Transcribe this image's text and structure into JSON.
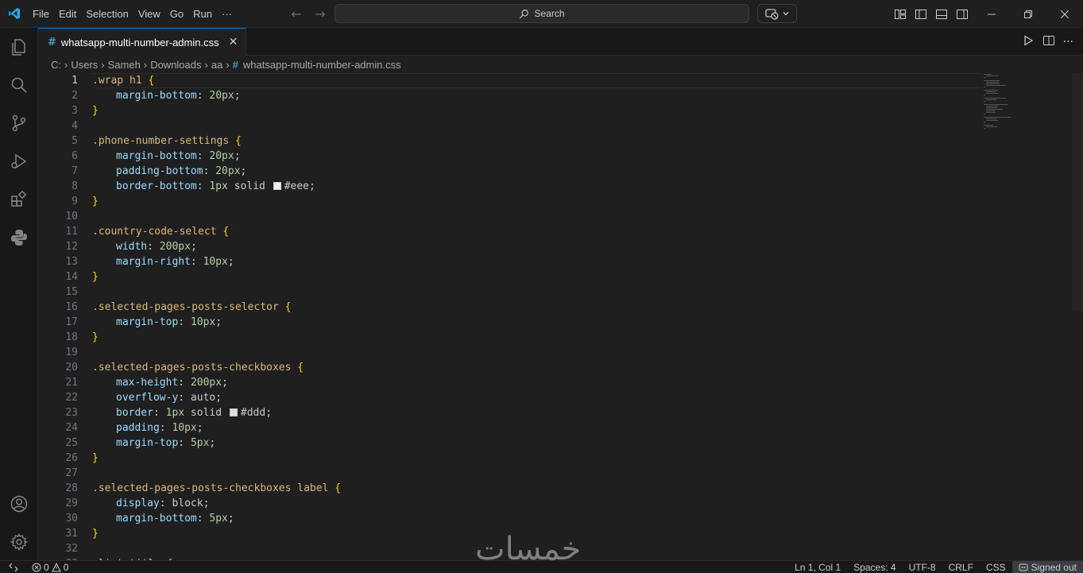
{
  "menu": [
    "File",
    "Edit",
    "Selection",
    "View",
    "Go",
    "Run",
    "···"
  ],
  "search": {
    "label": "Search"
  },
  "tab": {
    "filename": "whatsapp-multi-number-admin.css",
    "close": "✕"
  },
  "breadcrumb": [
    "C:",
    "Users",
    "Sameh",
    "Downloads",
    "aa",
    "whatsapp-multi-number-admin.css"
  ],
  "editor": {
    "active_line": 1,
    "lines": [
      [
        [
          "sel",
          ".wrap h1 "
        ],
        [
          "brace",
          "{"
        ]
      ],
      [
        [
          "ind",
          ""
        ],
        [
          "prop",
          "margin-bottom"
        ],
        [
          "val",
          ": "
        ],
        [
          "num",
          "20px"
        ],
        [
          "val",
          ";"
        ]
      ],
      [
        [
          "brace",
          "}"
        ]
      ],
      [],
      [
        [
          "sel",
          ".phone-number-settings "
        ],
        [
          "brace",
          "{"
        ]
      ],
      [
        [
          "ind",
          ""
        ],
        [
          "prop",
          "margin-bottom"
        ],
        [
          "val",
          ": "
        ],
        [
          "num",
          "20px"
        ],
        [
          "val",
          ";"
        ]
      ],
      [
        [
          "ind",
          ""
        ],
        [
          "prop",
          "padding-bottom"
        ],
        [
          "val",
          ": "
        ],
        [
          "num",
          "20px"
        ],
        [
          "val",
          ";"
        ]
      ],
      [
        [
          "ind",
          ""
        ],
        [
          "prop",
          "border-bottom"
        ],
        [
          "val",
          ": "
        ],
        [
          "num",
          "1px"
        ],
        [
          "val",
          " solid "
        ],
        [
          "swatch",
          "#eeeeee"
        ],
        [
          "val",
          "#eee;"
        ]
      ],
      [
        [
          "brace",
          "}"
        ]
      ],
      [],
      [
        [
          "sel",
          ".country-code-select "
        ],
        [
          "brace",
          "{"
        ]
      ],
      [
        [
          "ind",
          ""
        ],
        [
          "prop",
          "width"
        ],
        [
          "val",
          ": "
        ],
        [
          "num",
          "200px"
        ],
        [
          "val",
          ";"
        ]
      ],
      [
        [
          "ind",
          ""
        ],
        [
          "prop",
          "margin-right"
        ],
        [
          "val",
          ": "
        ],
        [
          "num",
          "10px"
        ],
        [
          "val",
          ";"
        ]
      ],
      [
        [
          "brace",
          "}"
        ]
      ],
      [],
      [
        [
          "sel",
          ".selected-pages-posts-selector "
        ],
        [
          "brace",
          "{"
        ]
      ],
      [
        [
          "ind",
          ""
        ],
        [
          "prop",
          "margin-top"
        ],
        [
          "val",
          ": "
        ],
        [
          "num",
          "10px"
        ],
        [
          "val",
          ";"
        ]
      ],
      [
        [
          "brace",
          "}"
        ]
      ],
      [],
      [
        [
          "sel",
          ".selected-pages-posts-checkboxes "
        ],
        [
          "brace",
          "{"
        ]
      ],
      [
        [
          "ind",
          ""
        ],
        [
          "prop",
          "max-height"
        ],
        [
          "val",
          ": "
        ],
        [
          "num",
          "200px"
        ],
        [
          "val",
          ";"
        ]
      ],
      [
        [
          "ind",
          ""
        ],
        [
          "prop",
          "overflow-y"
        ],
        [
          "val",
          ": auto;"
        ]
      ],
      [
        [
          "ind",
          ""
        ],
        [
          "prop",
          "border"
        ],
        [
          "val",
          ": "
        ],
        [
          "num",
          "1px"
        ],
        [
          "val",
          " solid "
        ],
        [
          "swatch",
          "#dddddd"
        ],
        [
          "val",
          "#ddd;"
        ]
      ],
      [
        [
          "ind",
          ""
        ],
        [
          "prop",
          "padding"
        ],
        [
          "val",
          ": "
        ],
        [
          "num",
          "10px"
        ],
        [
          "val",
          ";"
        ]
      ],
      [
        [
          "ind",
          ""
        ],
        [
          "prop",
          "margin-top"
        ],
        [
          "val",
          ": "
        ],
        [
          "num",
          "5px"
        ],
        [
          "val",
          ";"
        ]
      ],
      [
        [
          "brace",
          "}"
        ]
      ],
      [],
      [
        [
          "sel",
          ".selected-pages-posts-checkboxes label "
        ],
        [
          "brace",
          "{"
        ]
      ],
      [
        [
          "ind",
          ""
        ],
        [
          "prop",
          "display"
        ],
        [
          "val",
          ": block;"
        ]
      ],
      [
        [
          "ind",
          ""
        ],
        [
          "prop",
          "margin-bottom"
        ],
        [
          "val",
          ": "
        ],
        [
          "num",
          "5px"
        ],
        [
          "val",
          ";"
        ]
      ],
      [
        [
          "brace",
          "}"
        ]
      ],
      [],
      [
        [
          "sel",
          ".list-title "
        ],
        [
          "brace",
          "{"
        ]
      ]
    ]
  },
  "status": {
    "errors": "0",
    "warnings": "0",
    "position": "Ln 1, Col 1",
    "spaces": "Spaces: 4",
    "encoding": "UTF-8",
    "eol": "CRLF",
    "language": "CSS",
    "account": "Signed out"
  },
  "watermark": "خمسات",
  "colors": {
    "accent": "#0078d4",
    "selector": "#d7ba7d",
    "property": "#9cdcfe",
    "number": "#b5cea8",
    "brace": "#ffd700"
  }
}
